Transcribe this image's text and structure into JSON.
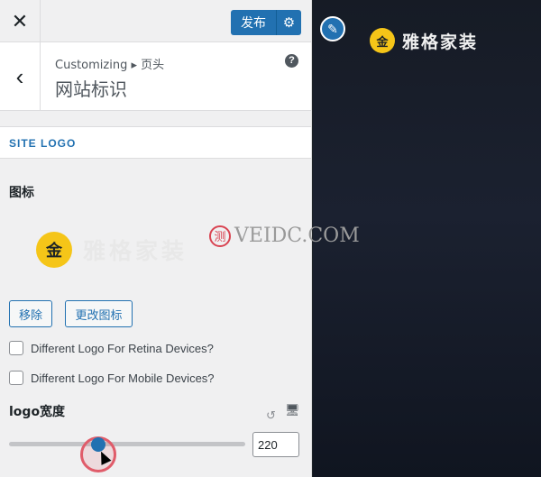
{
  "topbar": {
    "close_glyph": "✕",
    "publish_label": "发布",
    "publish_gear": "⚙"
  },
  "header": {
    "back_glyph": "‹",
    "breadcrumb": "Customizing ▸ 页头",
    "title": "网站标识",
    "help": "?"
  },
  "section": {
    "title": "SITE LOGO"
  },
  "logo": {
    "label": "图标",
    "mark": "金",
    "text": "雅格家装"
  },
  "buttons": {
    "remove": "移除",
    "change": "更改图标"
  },
  "checkboxes": [
    {
      "label": "Different Logo For Retina Devices?",
      "checked": false
    },
    {
      "label": "Different Logo For Mobile Devices?",
      "checked": false
    }
  ],
  "width": {
    "label": "logo宽度",
    "value": "220",
    "slider_fraction": 0.37,
    "reset_glyph": "↺",
    "device_glyph": "🖥"
  },
  "preview": {
    "edit_glyph": "✎",
    "logo_mark": "金",
    "logo_text": "雅格家装"
  },
  "watermark": {
    "mark": "测",
    "text": "VEIDC.COM"
  },
  "colors": {
    "accent": "#2271b1",
    "logo_yellow": "#f5c518",
    "ring": "#e05c6a"
  }
}
